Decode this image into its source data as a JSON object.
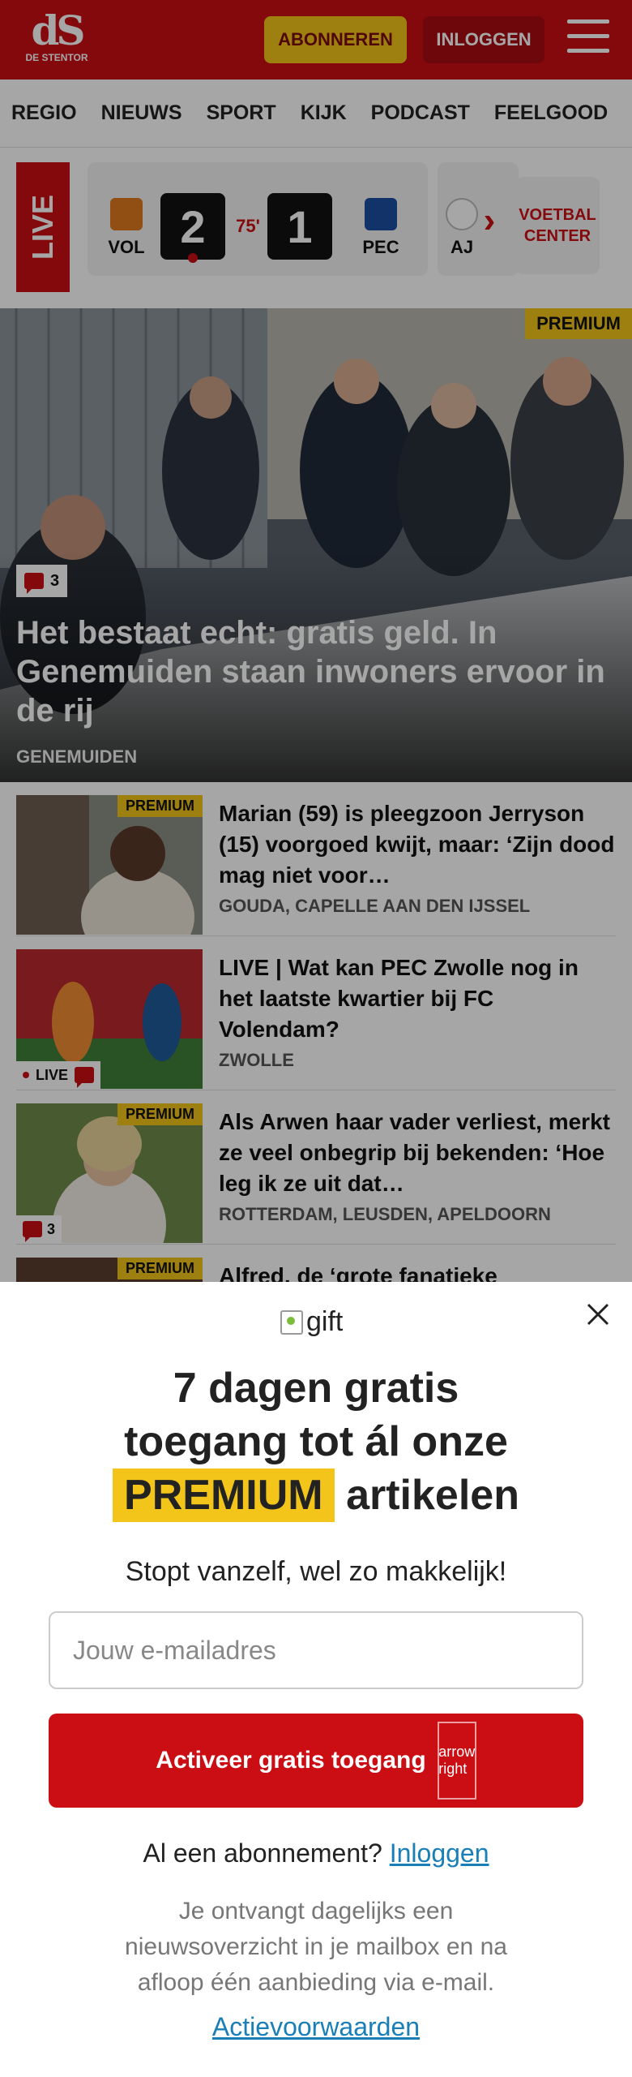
{
  "header": {
    "logo_main": "dS",
    "logo_sub": "DE STENTOR",
    "subscribe_label": "ABONNEREN",
    "login_label": "INLOGGEN",
    "brand_color": "#cb0e14",
    "accent_color": "#f3c51a"
  },
  "nav": {
    "items": [
      "REGIO",
      "NIEUWS",
      "SPORT",
      "KIJK",
      "PODCAST",
      "FEELGOOD"
    ]
  },
  "live": {
    "label": "LIVE",
    "match": {
      "home": "VOL",
      "home_score": "2",
      "minute": "75'",
      "away_score": "1",
      "away": "PEC"
    },
    "next_team": "AJ",
    "center_label": "VOETBAL CENTER"
  },
  "hero": {
    "badge": "PREMIUM",
    "comment_count": "3",
    "title": "Het bestaat echt: gratis geld. In Genemuiden staan inwoners ervoor in de rij",
    "location": "GENEMUIDEN"
  },
  "articles": [
    {
      "badge": "PREMIUM",
      "title": "Marian (59) is pleegzoon Jerryson (15) voorgoed kwijt, maar: ‘Zijn dood mag niet voor…",
      "location": "GOUDA, CAPELLE AAN DEN IJSSEL"
    },
    {
      "live_label": "LIVE",
      "title": "LIVE | Wat kan PEC Zwolle nog in het laatste kwartier bij FC Volendam?",
      "location": "ZWOLLE"
    },
    {
      "badge": "PREMIUM",
      "comment_count": "3",
      "title": "Als Arwen haar vader verliest, merkt ze veel onbegrip bij bekenden: ‘Hoe leg ik ze uit dat…",
      "location": "ROTTERDAM, LEUSDEN, APELDOORN"
    },
    {
      "badge": "PREMIUM",
      "title": "Alfred, de ‘grote fanatieke"
    }
  ],
  "modal": {
    "gift_alt": "gift",
    "title_line1": "7 dagen gratis",
    "title_line2": "toegang tot ál onze",
    "title_premium": "PREMIUM",
    "title_line3_rest": "artikelen",
    "subtitle": "Stopt vanzelf, wel zo makkelijk!",
    "email_placeholder": "Jouw e-mailadres",
    "cta_label": "Activeer gratis toegang",
    "cta_icon_alt": "arrow right",
    "login_prefix": "Al een abonnement?",
    "login_link": "Inloggen",
    "note": "Je ontvangt dagelijks een nieuwsoverzicht in je mailbox en na afloop één aanbieding via e-mail.",
    "terms_link": "Actievoorwaarden",
    "link_color": "#1a7fb6"
  }
}
